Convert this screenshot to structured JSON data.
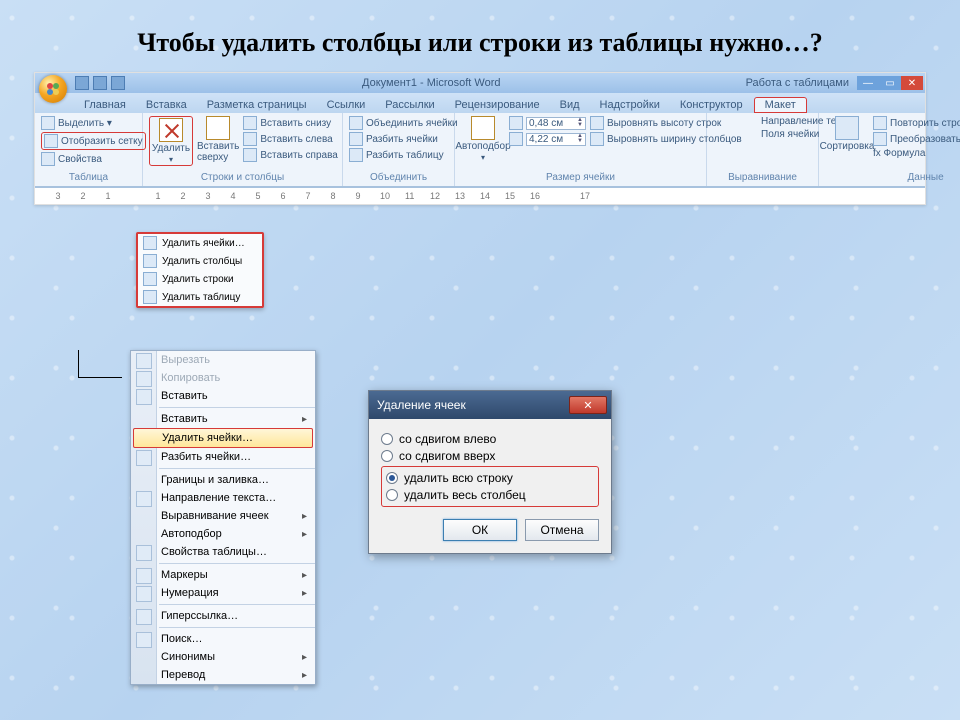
{
  "title": "Чтобы удалить столбцы или строки из таблицы нужно…?",
  "window": {
    "doc_title": "Документ1 - Microsoft Word",
    "context_group": "Работа с таблицами"
  },
  "tabs": {
    "home": "Главная",
    "insert": "Вставка",
    "layout_page": "Разметка страницы",
    "refs": "Ссылки",
    "mail": "Рассылки",
    "review": "Рецензирование",
    "view": "Вид",
    "addins": "Надстройки",
    "design": "Конструктор",
    "layout": "Макет"
  },
  "ribbon": {
    "select": "Выделить ▾",
    "gridlines": "Отобразить сетку",
    "properties": "Свойства",
    "delete": "Удалить",
    "insert_top": "Вставить сверху",
    "ins_below": "Вставить снизу",
    "ins_left": "Вставить слева",
    "ins_right": "Вставить справа",
    "merge": "Объединить ячейки",
    "split": "Разбить ячейки",
    "split_tbl": "Разбить таблицу",
    "autofit": "Автоподбор",
    "h_val": "0,48 см",
    "w_val": "4,22 см",
    "dist_rows": "Выровнять высоту строк",
    "dist_cols": "Выровнять ширину столбцов",
    "text_dir": "Направление текста",
    "cell_margins": "Поля ячейки",
    "sort": "Сортировка",
    "repeat_hdr": "Повторить строки заголовков",
    "to_text": "Преобразовать в текст",
    "formula": "fx Формула",
    "g_table": "Таблица",
    "g_rc": "Строки и столбцы",
    "g_merge": "Объединить",
    "g_size": "Размер ячейки",
    "g_align": "Выравнивание",
    "g_data": "Данные"
  },
  "delete_menu": {
    "cells": "Удалить ячейки…",
    "cols": "Удалить столбцы",
    "rows": "Удалить строки",
    "table": "Удалить таблицу"
  },
  "context_menu": {
    "cut": "Вырезать",
    "copy": "Копировать",
    "paste": "Вставить",
    "insert": "Вставить",
    "del_cells": "Удалить ячейки…",
    "split": "Разбить ячейки…",
    "borders": "Границы и заливка…",
    "text_dir": "Направление текста…",
    "cell_align": "Выравнивание ячеек",
    "autofit": "Автоподбор",
    "tbl_props": "Свойства таблицы…",
    "bullets": "Маркеры",
    "numbering": "Нумерация",
    "hyperlink": "Гиперссылка…",
    "lookup": "Поиск…",
    "synonyms": "Синонимы",
    "translate": "Перевод"
  },
  "dialog": {
    "title": "Удаление ячеек",
    "shift_left": "со сдвигом влево",
    "shift_up": "со сдвигом вверх",
    "del_row": "удалить всю строку",
    "del_col": "удалить весь столбец",
    "ok": "ОК",
    "cancel": "Отмена"
  },
  "ruler": [
    "3",
    "2",
    "1",
    "",
    "1",
    "2",
    "3",
    "4",
    "5",
    "6",
    "7",
    "8",
    "9",
    "10",
    "11",
    "12",
    "13",
    "14",
    "15",
    "16",
    "",
    "17"
  ]
}
